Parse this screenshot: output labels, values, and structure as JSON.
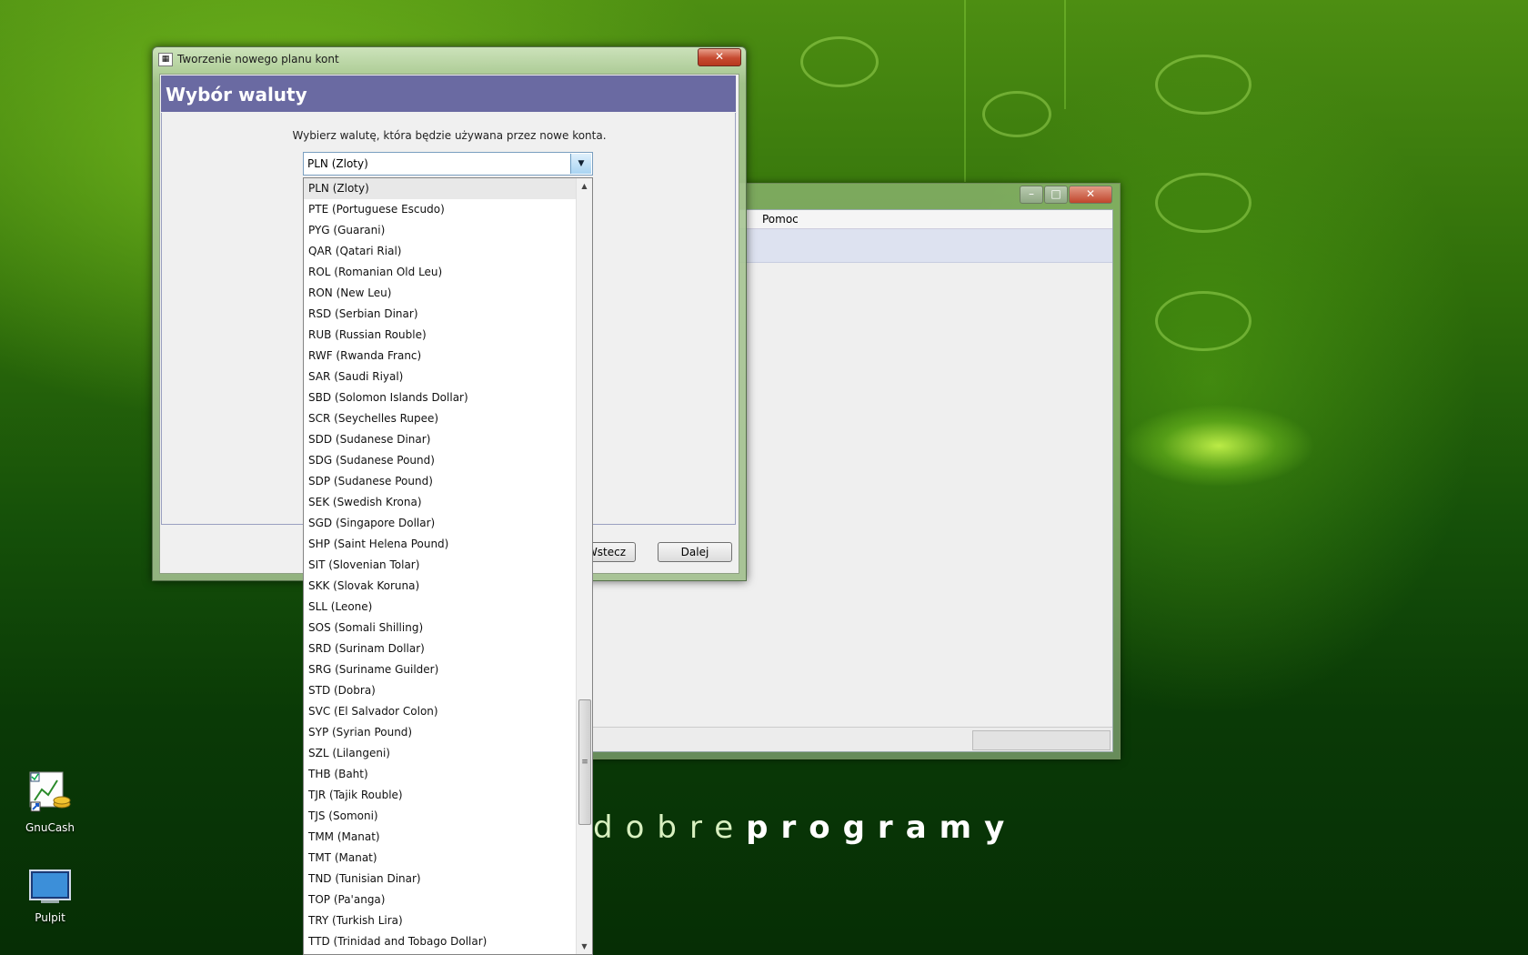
{
  "desktop": {
    "watermark_light": "dobre",
    "watermark_bold": "programy",
    "icons": [
      {
        "label": "GnuCash"
      },
      {
        "label": "Pulpit"
      }
    ]
  },
  "background_window": {
    "menu_help": "Pomoc"
  },
  "dialog": {
    "title": "Tworzenie nowego planu kont",
    "header": "Wybór waluty",
    "prompt": "Wybierz walutę, która będzie używana przez nowe konta.",
    "back_button": "Wstecz",
    "next_button": "Dalej",
    "currency_combo": {
      "value": "PLN (Zloty)",
      "options": [
        "PLN (Zloty)",
        "PTE (Portuguese Escudo)",
        "PYG (Guarani)",
        "QAR (Qatari Rial)",
        "ROL (Romanian Old Leu)",
        "RON (New Leu)",
        "RSD (Serbian Dinar)",
        "RUB (Russian Rouble)",
        "RWF (Rwanda Franc)",
        "SAR (Saudi Riyal)",
        "SBD (Solomon Islands Dollar)",
        "SCR (Seychelles Rupee)",
        "SDD (Sudanese Dinar)",
        "SDG (Sudanese Pound)",
        "SDP (Sudanese Pound)",
        "SEK (Swedish Krona)",
        "SGD (Singapore Dollar)",
        "SHP (Saint Helena Pound)",
        "SIT (Slovenian Tolar)",
        "SKK (Slovak Koruna)",
        "SLL (Leone)",
        "SOS (Somali Shilling)",
        "SRD (Surinam Dollar)",
        "SRG (Suriname Guilder)",
        "STD (Dobra)",
        "SVC (El Salvador Colon)",
        "SYP (Syrian Pound)",
        "SZL (Lilangeni)",
        "THB (Baht)",
        "TJR (Tajik Rouble)",
        "TJS (Somoni)",
        "TMM (Manat)",
        "TMT (Manat)",
        "TND (Tunisian Dinar)",
        "TOP (Pa'anga)",
        "TRY (Turkish Lira)",
        "TTD (Trinidad and Tobago Dollar)"
      ]
    }
  }
}
